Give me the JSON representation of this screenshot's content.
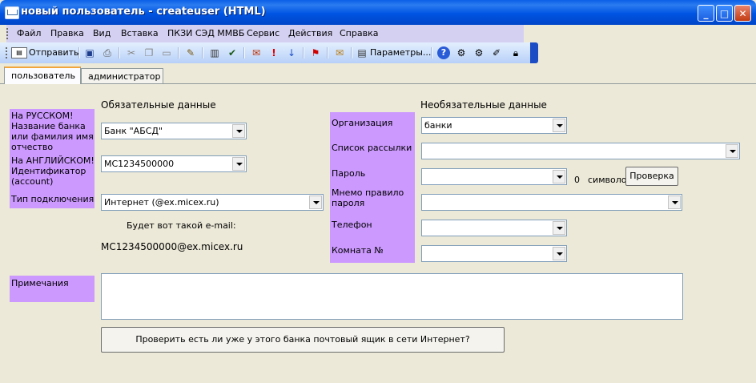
{
  "window": {
    "title": "новый пользователь - createuser (HTML)"
  },
  "menu": {
    "items": [
      "Файл",
      "Правка",
      "Вид",
      "Вставка",
      "ПКЗИ СЭД ММВБ",
      "Сервис",
      "Действия",
      "Справка"
    ]
  },
  "toolbar": {
    "send_label": "Отправить",
    "params_label": "Параметры..."
  },
  "tabs": [
    "пользователь",
    "администратор"
  ],
  "form": {
    "required_heading": "Обязательные данные",
    "optional_heading": "Необязательные данные",
    "label_russian": "На РУССКОМ! Название банка или фамилия  имя отчество",
    "label_english": "На АНГЛИЙСКОМ! Идентификатор (account)",
    "label_connection": "Тип подключения",
    "bank_value": "Банк \"АБСД\"",
    "account_value": "MC1234500000",
    "connection_value": "Интернет (@ex.micex.ru)",
    "email_caption": "Будет вот такой e-mail:",
    "email_value": "MC1234500000@ex.micex.ru",
    "label_organization": "Организация",
    "organization_value": "банки",
    "label_mailing": "Список рассылки",
    "mailing_value": "",
    "label_password": "Пароль",
    "password_value": "",
    "password_count": "0",
    "password_symbols": "символов",
    "check_button": "Проверка",
    "label_mnemonic": "Мнемо правило пароля",
    "mnemonic_value": "",
    "label_phone": "Телефон",
    "phone_value": "",
    "label_room": "Комната №",
    "room_value": "",
    "label_notes": "Примечания",
    "notes_value": "",
    "check_mailbox_button": "Проверить есть ли уже у этого банка почтовый ящик в сети Интернет?"
  }
}
